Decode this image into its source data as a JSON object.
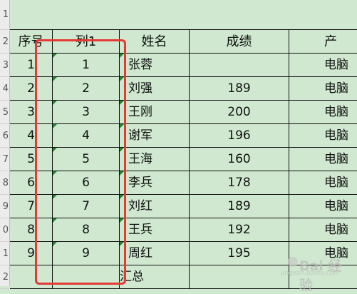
{
  "row_headers": [
    "1",
    "2",
    "3",
    "4",
    "5",
    "6",
    "7",
    "8",
    "9",
    "0",
    "1",
    "2"
  ],
  "headers": {
    "seq": "序号",
    "col1": "列1",
    "name": "姓名",
    "score": "成绩",
    "product": "产"
  },
  "rows": [
    {
      "seq": "1",
      "col1": "1",
      "name": "张蓉",
      "score": "",
      "product": "电脑"
    },
    {
      "seq": "2",
      "col1": "2",
      "name": "刘强",
      "score": "189",
      "product": "电脑"
    },
    {
      "seq": "3",
      "col1": "3",
      "name": "王刚",
      "score": "200",
      "product": "电脑"
    },
    {
      "seq": "4",
      "col1": "4",
      "name": "谢军",
      "score": "196",
      "product": "电脑"
    },
    {
      "seq": "5",
      "col1": "5",
      "name": "王海",
      "score": "160",
      "product": "电脑"
    },
    {
      "seq": "6",
      "col1": "6",
      "name": "李兵",
      "score": "178",
      "product": "电脑"
    },
    {
      "seq": "7",
      "col1": "7",
      "name": "刘红",
      "score": "189",
      "product": "电脑"
    },
    {
      "seq": "8",
      "col1": "8",
      "name": "王兵",
      "score": "192",
      "product": "电脑"
    },
    {
      "seq": "9",
      "col1": "9",
      "name": "周红",
      "score": "195",
      "product": "电脑"
    }
  ],
  "total_label": "汇总",
  "watermark": {
    "brand": "Bai 经验",
    "sub": "jingyan.baidu.com"
  }
}
